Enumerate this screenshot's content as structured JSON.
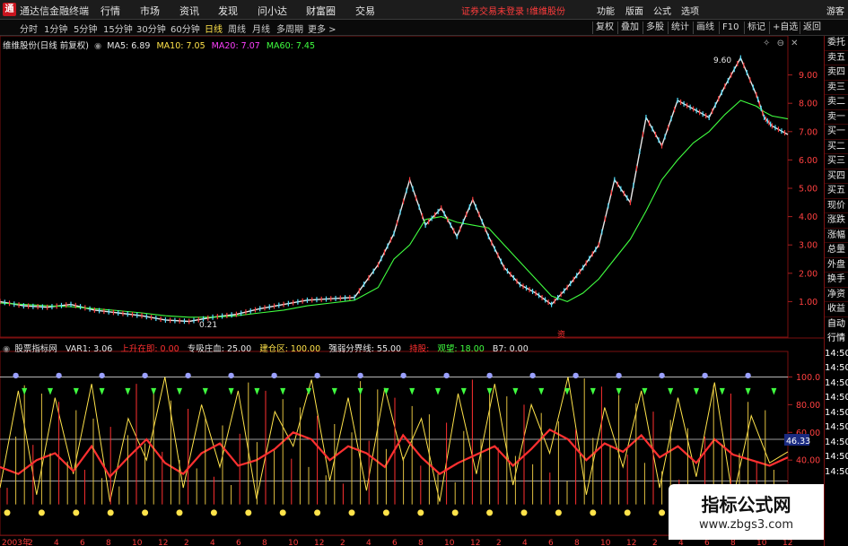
{
  "titlebar": {
    "app_title": "通达信金融终端",
    "menus": [
      "行情",
      "市场",
      "资讯",
      "发现",
      "问小达",
      "财富圈",
      "交易"
    ],
    "warning1": "证券交易未登录",
    "warning2": "!维维股份",
    "right_menus": [
      "功能",
      "版面",
      "公式",
      "选项"
    ],
    "guest": "游客"
  },
  "toolbar": {
    "periods": [
      "分时",
      "1分钟",
      "5分钟",
      "15分钟",
      "30分钟",
      "60分钟",
      "日线",
      "周线",
      "月线",
      "多周期",
      "更多 >"
    ],
    "active_period": "日线",
    "buttons": [
      "复权",
      "叠加",
      "多股",
      "统计",
      "画线",
      "F10",
      "标记",
      "+自选",
      "返回"
    ]
  },
  "sidebar": {
    "items": [
      "委托",
      "卖五",
      "卖四",
      "卖三",
      "卖二",
      "卖一",
      "买一",
      "买二",
      "买三",
      "买四",
      "买五",
      "现价",
      "涨跌",
      "涨幅",
      "总量",
      "外盘",
      "换手",
      "净资",
      "收益",
      "自动",
      "行情",
      "14:50",
      "14:50",
      "14:50",
      "14:50",
      "14:50",
      "14:50",
      "14:50",
      "14:50",
      "14:50"
    ]
  },
  "price_panel": {
    "name": "维维股份(日线 前复权)",
    "ma": [
      {
        "label": "MA5: 6.89",
        "color": "#e8e8e8"
      },
      {
        "label": "MA10: 7.05",
        "color": "#ffe34a"
      },
      {
        "label": "MA20: 7.07",
        "color": "#ff40ff"
      },
      {
        "label": "MA60: 7.45",
        "color": "#40ff40"
      }
    ],
    "max_label": "9.60",
    "min_label": "0.21",
    "markers": [
      "资"
    ]
  },
  "indicator_panel": {
    "name": "股票指标网",
    "items": [
      {
        "label": "VAR1: 3.06",
        "color": "#e8e8e8"
      },
      {
        "label": "上升在即: 0.00",
        "color": "#ff3030"
      },
      {
        "label": "专吸庄血: 25.00",
        "color": "#e8e8e8"
      },
      {
        "label": "建仓区: 100.00",
        "color": "#ffe34a"
      },
      {
        "label": "强弱分界线: 55.00",
        "color": "#e8e8e8"
      },
      {
        "label": "持股: ",
        "color": "#ff3030"
      },
      {
        "label": "观望: 18.00",
        "color": "#40ff40"
      },
      {
        "label": "B7: 0.00",
        "color": "#e8e8e8"
      }
    ],
    "current_value_label": "46.33"
  },
  "watermark": {
    "title": "指标公式网",
    "url": "www.zbgs3.com"
  },
  "chart_data": [
    {
      "type": "line",
      "title": "维维股份(日线 前复权)",
      "ylim": [
        0.0,
        10.0
      ],
      "yticks": [
        1.0,
        2.0,
        3.0,
        4.0,
        5.0,
        6.0,
        7.0,
        8.0,
        9.0
      ],
      "ytick_labels": [
        "1.00",
        "2.00",
        "3.00",
        "4.00",
        "5.00",
        "6.00",
        "7.00",
        "8.00",
        "9.00"
      ],
      "x_tick_labels": [
        "2003年",
        "2",
        "4",
        "6",
        "8",
        "10",
        "12",
        "2",
        "4",
        "6",
        "8",
        "10",
        "12",
        "2",
        "4",
        "6",
        "8",
        "10",
        "12",
        "2",
        "4",
        "6",
        "8",
        "10",
        "12",
        "2",
        "4",
        "6",
        "8",
        "10",
        "12"
      ],
      "x": [
        0,
        3,
        6,
        9,
        12,
        15,
        18,
        21,
        24,
        27,
        30,
        33,
        36,
        39,
        42,
        45,
        48,
        50,
        52,
        54,
        56,
        58,
        60,
        62,
        64,
        66,
        68,
        70,
        72,
        74,
        76,
        78,
        80,
        82,
        84,
        86,
        88,
        90,
        92,
        94,
        96,
        97,
        98,
        100
      ],
      "series": [
        {
          "name": "MA5",
          "color": "#e8e8e8",
          "values": [
            1.0,
            0.85,
            0.8,
            0.9,
            0.7,
            0.6,
            0.5,
            0.35,
            0.3,
            0.45,
            0.55,
            0.75,
            0.9,
            1.05,
            1.1,
            1.15,
            2.3,
            3.4,
            5.3,
            3.7,
            4.3,
            3.3,
            4.6,
            3.3,
            2.2,
            1.6,
            1.3,
            0.9,
            1.5,
            2.2,
            3.0,
            5.3,
            4.5,
            7.5,
            6.5,
            8.1,
            7.8,
            7.5,
            8.6,
            9.6,
            8.3,
            7.5,
            7.2,
            6.9
          ]
        },
        {
          "name": "MA60",
          "color": "#40ff40",
          "values": [
            0.95,
            0.9,
            0.85,
            0.82,
            0.75,
            0.68,
            0.6,
            0.5,
            0.45,
            0.45,
            0.5,
            0.6,
            0.7,
            0.85,
            0.95,
            1.05,
            1.5,
            2.5,
            3.0,
            3.9,
            4.0,
            3.8,
            3.7,
            3.6,
            3.0,
            2.4,
            1.8,
            1.2,
            1.0,
            1.3,
            1.8,
            2.5,
            3.2,
            4.2,
            5.3,
            6.0,
            6.6,
            7.0,
            7.6,
            8.1,
            7.9,
            7.7,
            7.55,
            7.45
          ]
        }
      ]
    },
    {
      "type": "line",
      "title": "股票指标网",
      "ylim": [
        0,
        110
      ],
      "yticks": [
        20,
        40,
        60,
        80,
        100
      ],
      "ytick_labels": [
        "20.00",
        "40.00",
        "60.00",
        "80.00",
        "100.0"
      ],
      "reference_lines": [
        25,
        55,
        100
      ],
      "series": [
        {
          "name": "VAR1",
          "color": "#ffe34a",
          "values": [
            20,
            90,
            15,
            85,
            30,
            95,
            10,
            70,
            40,
            100,
            20,
            80,
            35,
            90,
            12,
            75,
            50,
            98,
            25,
            85,
            18,
            92,
            40,
            70,
            10,
            88,
            30,
            95,
            22,
            80,
            45,
            100,
            15,
            78,
            35,
            90,
            20,
            85,
            28,
            96,
            12,
            72,
            38,
            46
          ]
        },
        {
          "name": "持股",
          "color": "#ff3030",
          "values": [
            35,
            30,
            40,
            45,
            32,
            50,
            28,
            42,
            55,
            38,
            30,
            45,
            52,
            36,
            40,
            48,
            60,
            55,
            40,
            50,
            45,
            35,
            58,
            42,
            30,
            38,
            44,
            50,
            36,
            48,
            62,
            55,
            40,
            52,
            46,
            58,
            42,
            50,
            38,
            55,
            44,
            40,
            36,
            42
          ]
        }
      ]
    }
  ]
}
